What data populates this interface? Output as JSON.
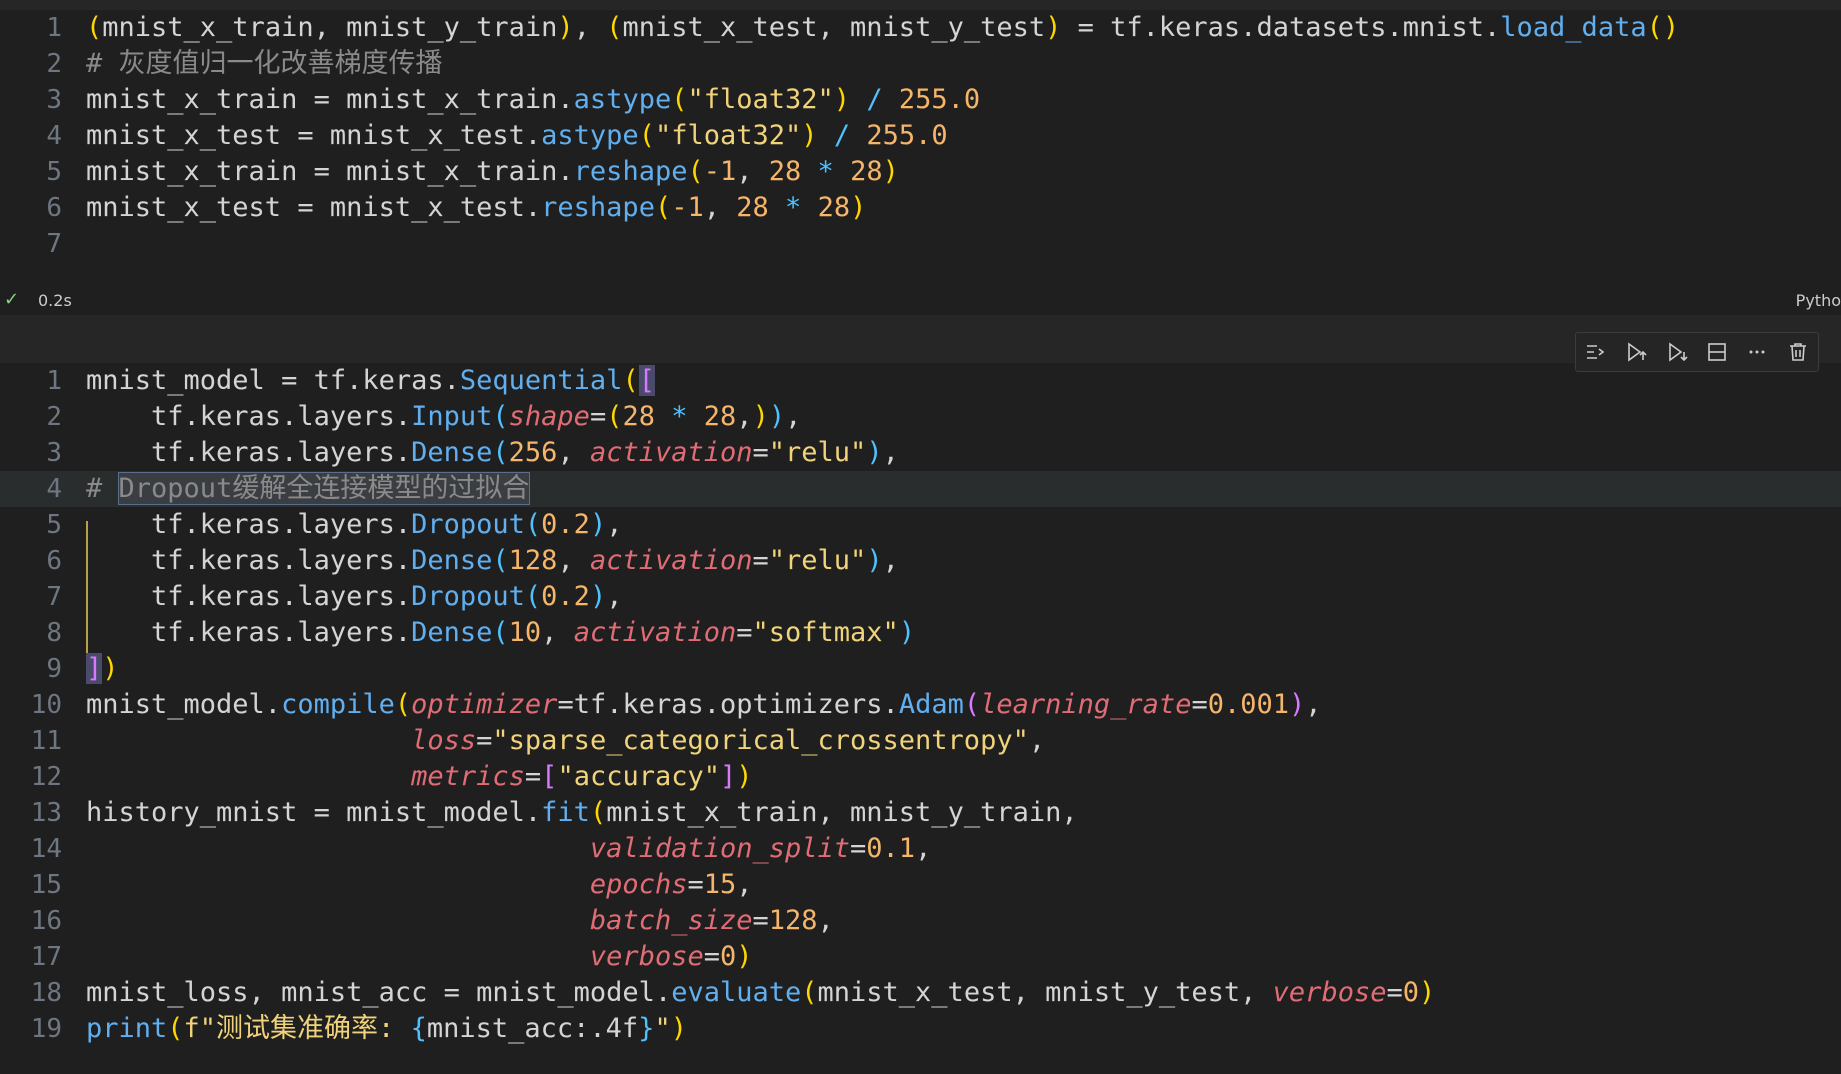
{
  "cell1": {
    "lines": [
      {
        "n": "1",
        "text": "(mnist_x_train, mnist_y_train), (mnist_x_test, mnist_y_test) = tf.keras.datasets.mnist.load_data()"
      },
      {
        "n": "2",
        "text": "# 灰度值归一化改善梯度传播"
      },
      {
        "n": "3",
        "text": "mnist_x_train = mnist_x_train.astype(\"float32\") / 255.0"
      },
      {
        "n": "4",
        "text": "mnist_x_test = mnist_x_test.astype(\"float32\") / 255.0"
      },
      {
        "n": "5",
        "text": "mnist_x_train = mnist_x_train.reshape(-1, 28 * 28)"
      },
      {
        "n": "6",
        "text": "mnist_x_test = mnist_x_test.reshape(-1, 28 * 28)"
      },
      {
        "n": "7",
        "text": ""
      }
    ],
    "status": {
      "check": "✓",
      "time": "0.2s",
      "language": "Pytho"
    }
  },
  "toolbar": {
    "icons": [
      "run-by-line-icon",
      "execute-above-icon",
      "execute-below-icon",
      "split-cell-icon",
      "more-icon",
      "delete-icon"
    ]
  },
  "cell2": {
    "lines": [
      {
        "n": "1",
        "text": "mnist_model = tf.keras.Sequential(["
      },
      {
        "n": "2",
        "text": "    tf.keras.layers.Input(shape=(28 * 28,)),"
      },
      {
        "n": "3",
        "text": "    tf.keras.layers.Dense(256, activation=\"relu\"),"
      },
      {
        "n": "4",
        "text": "# Dropout缓解全连接模型的过拟合"
      },
      {
        "n": "5",
        "text": "    tf.keras.layers.Dropout(0.2),"
      },
      {
        "n": "6",
        "text": "    tf.keras.layers.Dense(128, activation=\"relu\"),"
      },
      {
        "n": "7",
        "text": "    tf.keras.layers.Dropout(0.2),"
      },
      {
        "n": "8",
        "text": "    tf.keras.layers.Dense(10, activation=\"softmax\")"
      },
      {
        "n": "9",
        "text": "])"
      },
      {
        "n": "10",
        "text": "mnist_model.compile(optimizer=tf.keras.optimizers.Adam(learning_rate=0.001),"
      },
      {
        "n": "11",
        "text": "                    loss=\"sparse_categorical_crossentropy\","
      },
      {
        "n": "12",
        "text": "                    metrics=[\"accuracy\"])"
      },
      {
        "n": "13",
        "text": "history_mnist = mnist_model.fit(mnist_x_train, mnist_y_train,"
      },
      {
        "n": "14",
        "text": "                               validation_split=0.1,"
      },
      {
        "n": "15",
        "text": "                               epochs=15,"
      },
      {
        "n": "16",
        "text": "                               batch_size=128,"
      },
      {
        "n": "17",
        "text": "                               verbose=0)"
      },
      {
        "n": "18",
        "text": "mnist_loss, mnist_acc = mnist_model.evaluate(mnist_x_test, mnist_y_test, verbose=0)"
      },
      {
        "n": "19",
        "text": "print(f\"测试集准确率: {mnist_acc:.4f}\")"
      }
    ]
  }
}
